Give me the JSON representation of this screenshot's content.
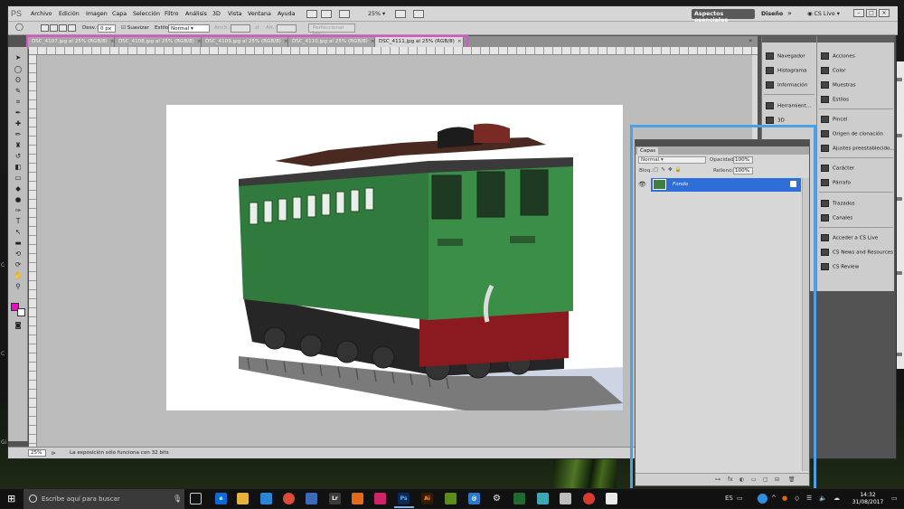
{
  "app": {
    "logo": "PS",
    "menus": [
      "Archivo",
      "Edición",
      "Imagen",
      "Capa",
      "Selección",
      "Filtro",
      "Análisis",
      "3D",
      "Vista",
      "Ventana",
      "Ayuda"
    ],
    "zoom": "25%",
    "workspace_active": "Aspectos esenciales",
    "workspace_other": "Diseño",
    "more": "»",
    "cs_live": "CS Live",
    "window_buttons": [
      "–",
      "□",
      "×"
    ]
  },
  "options": {
    "desv_label": "Desv.:",
    "desv_value": "0 px",
    "suavizar": "Suavizar",
    "estilo_label": "Estilo:",
    "estilo_value": "Normal",
    "anch_label": "Anch.:",
    "alt_label": "Alt.:",
    "refine_button": "Perfeccionar bor..."
  },
  "tabs": [
    {
      "label": "DSC_4107.jpg al 25% (RGB/8)",
      "close": "×"
    },
    {
      "label": "DSC_4108.jpg al 25% (RGB/8)",
      "close": "×"
    },
    {
      "label": "DSC_4109.jpg al 25% (RGB/8)",
      "close": "×"
    },
    {
      "label": "DSC_4110.jpg al 25% (RGB/8)",
      "close": "×"
    },
    {
      "label": "DSC_4111.jpg al 25% (RGB/8)",
      "close": "×"
    }
  ],
  "status": {
    "zoom": "25%",
    "message": "La exposición sólo funciona con 32 bits"
  },
  "dock": {
    "col1": [
      "Navegador",
      "Histograma",
      "Información",
      "Herramient...",
      "3D"
    ],
    "col2": [
      "Acciones",
      "Color",
      "Muestras",
      "Estilos",
      "Pincel",
      "Origen de clonación",
      "Ajustes preestablecido...",
      "Carácter",
      "Párrafo",
      "Trazados",
      "Canales",
      "Acceder a CS Live",
      "CS News and Resources",
      "CS Review"
    ]
  },
  "layers": {
    "tab": "Capas",
    "blend_mode": "Normal",
    "opacity_label": "Opacidad:",
    "opacity_value": "100%",
    "lock_label": "Bloq.:",
    "fill_label": "Relleno:",
    "fill_value": "100%",
    "layer_name": "Fondo",
    "bottom_icons": [
      "fx",
      "◐",
      "▭",
      "▢",
      "⊟",
      "🗑"
    ]
  },
  "taskbar": {
    "search_placeholder": "Escribe aquí para buscar",
    "language": "ES",
    "time": "14:32",
    "date": "31/08/2017"
  },
  "colors": {
    "foreground": "#ff00cc",
    "background": "#ffffff",
    "tab_highlight": "#e84ad6",
    "panel_highlight": "#4ba1e3",
    "selected_layer": "#2e6ed8"
  }
}
